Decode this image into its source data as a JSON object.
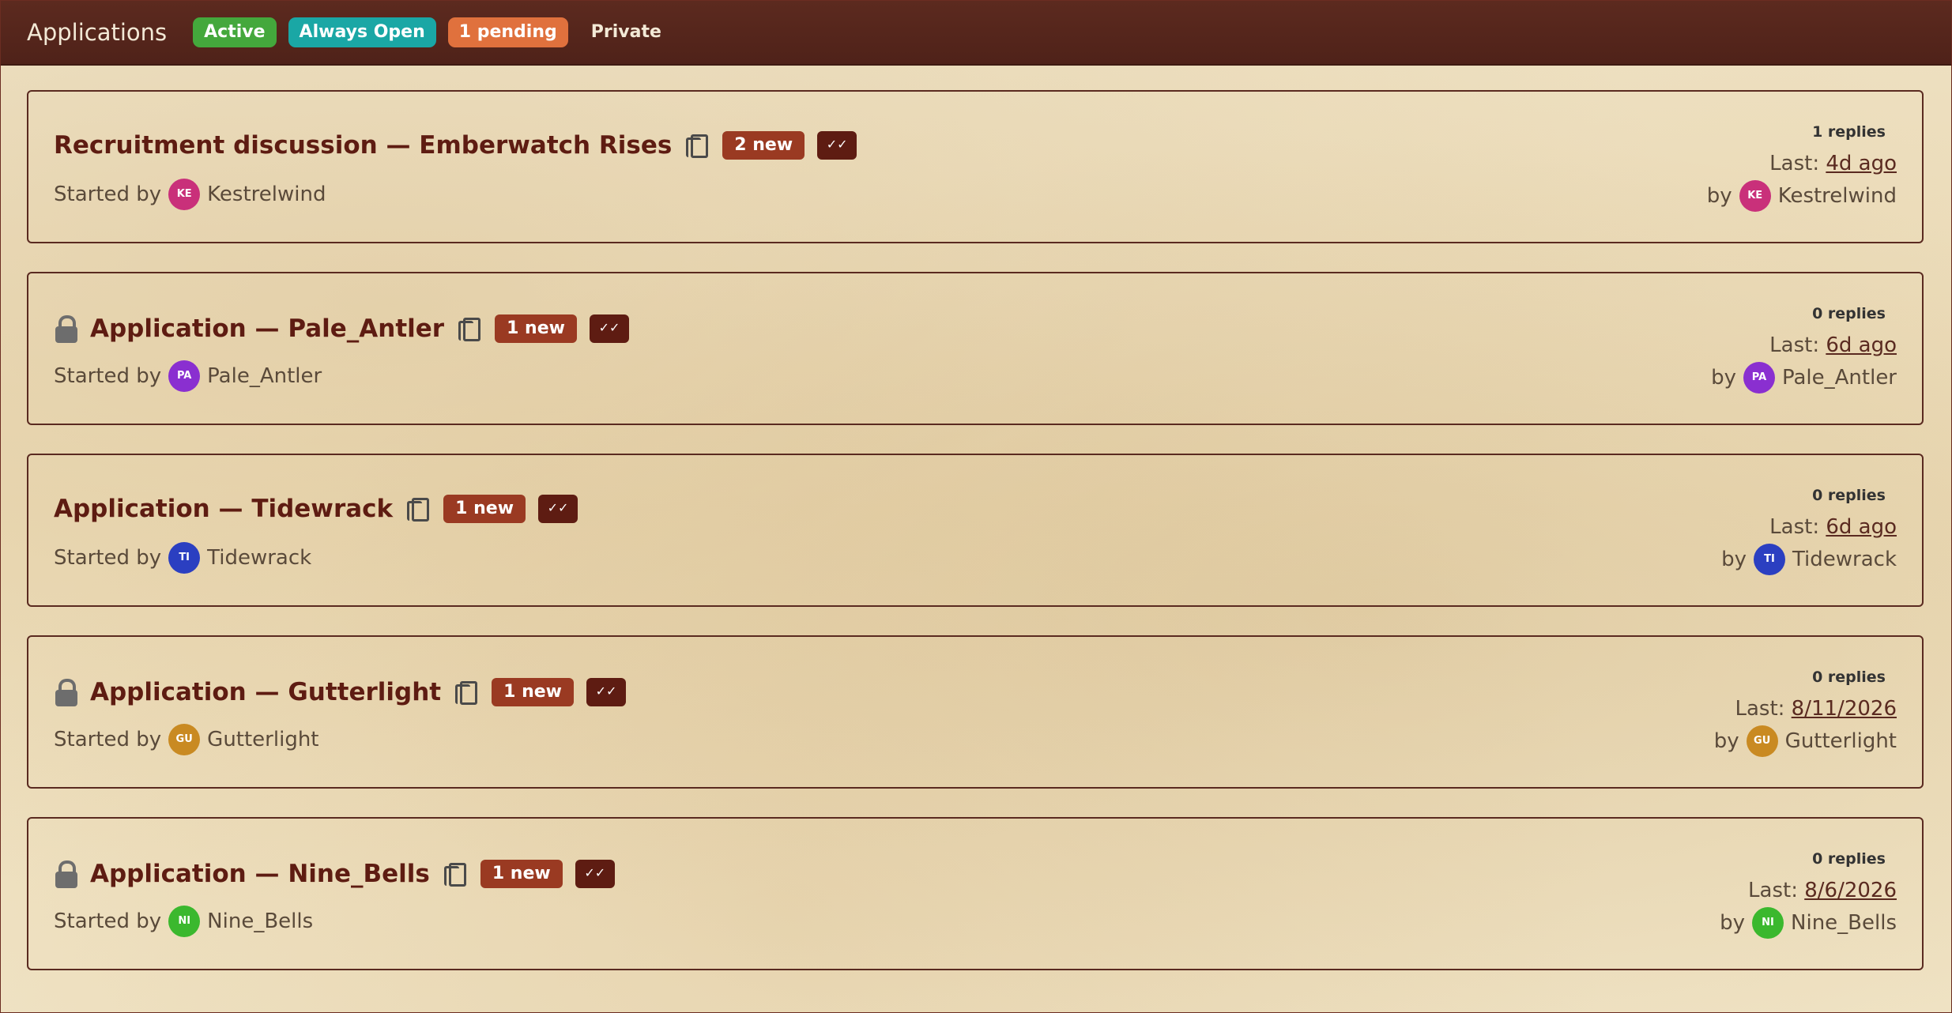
{
  "header": {
    "title": "Applications",
    "badges": {
      "active": "Active",
      "open": "Always Open",
      "pending": "1 pending",
      "private": "Private"
    }
  },
  "labels": {
    "started_by": "Started by",
    "last": "Last:",
    "by": "by",
    "mark_read_icon": "✓✓"
  },
  "colors": {
    "header_bg": "#5c2a1f",
    "title": "#5e1c12",
    "new_badge": "#9a3a22"
  },
  "topics": [
    {
      "title": "Recruitment discussion — Emberwatch Rises",
      "locked": false,
      "new": "2 new",
      "starter": "Kestrelwind",
      "initials": "KE",
      "avatar_color": "#c9307a",
      "replies": "1 replies",
      "last": "4d ago",
      "last_by": "Kestrelwind"
    },
    {
      "title": "Application — Pale_Antler",
      "locked": true,
      "new": "1 new",
      "starter": "Pale_Antler",
      "initials": "PA",
      "avatar_color": "#8a2fd0",
      "replies": "0 replies",
      "last": "6d ago",
      "last_by": "Pale_Antler"
    },
    {
      "title": "Application — Tidewrack",
      "locked": false,
      "new": "1 new",
      "starter": "Tidewrack",
      "initials": "TI",
      "avatar_color": "#2b3fc1",
      "replies": "0 replies",
      "last": "6d ago",
      "last_by": "Tidewrack"
    },
    {
      "title": "Application — Gutterlight",
      "locked": true,
      "new": "1 new",
      "starter": "Gutterlight",
      "initials": "GU",
      "avatar_color": "#c98a22",
      "replies": "0 replies",
      "last": "8/11/2026",
      "last_by": "Gutterlight"
    },
    {
      "title": "Application — Nine_Bells",
      "locked": true,
      "new": "1 new",
      "starter": "Nine_Bells",
      "initials": "NI",
      "avatar_color": "#3bb82e",
      "replies": "0 replies",
      "last": "8/6/2026",
      "last_by": "Nine_Bells"
    }
  ]
}
